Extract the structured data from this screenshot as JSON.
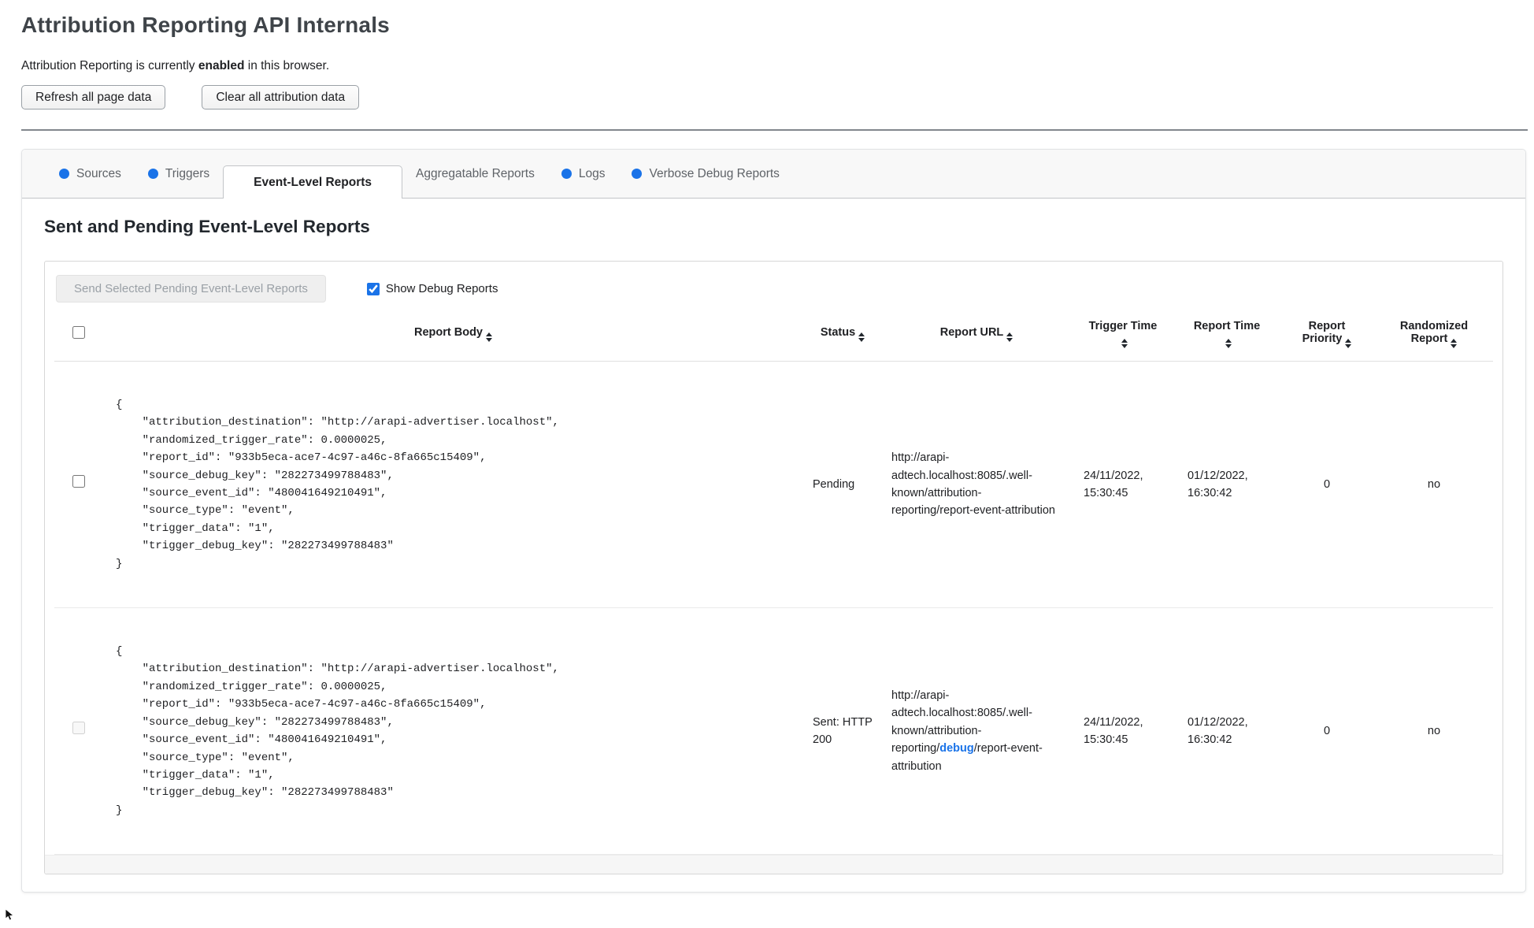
{
  "page": {
    "title": "Attribution Reporting API Internals",
    "status_prefix": "Attribution Reporting is currently ",
    "status_bold": "enabled",
    "status_suffix": " in this browser.",
    "refresh_button": "Refresh all page data",
    "clear_button": "Clear all attribution data"
  },
  "tabs": [
    {
      "label": "Sources",
      "has_dot": true,
      "active": false
    },
    {
      "label": "Triggers",
      "has_dot": true,
      "active": false
    },
    {
      "label": "Event-Level Reports",
      "has_dot": false,
      "active": true
    },
    {
      "label": "Aggregatable Reports",
      "has_dot": false,
      "active": false
    },
    {
      "label": "Logs",
      "has_dot": true,
      "active": false
    },
    {
      "label": "Verbose Debug Reports",
      "has_dot": true,
      "active": false
    }
  ],
  "section": {
    "heading": "Sent and Pending Event-Level Reports",
    "send_button": "Send Selected Pending Event-Level Reports",
    "send_button_disabled": true,
    "show_debug_label": "Show Debug Reports",
    "show_debug_checked": true
  },
  "table": {
    "columns": [
      "Report Body",
      "Status",
      "Report URL",
      "Trigger Time",
      "Report Time",
      "Report Priority",
      "Randomized Report"
    ],
    "rows": [
      {
        "report_body": "{\n    \"attribution_destination\": \"http://arapi-advertiser.localhost\",\n    \"randomized_trigger_rate\": 0.0000025,\n    \"report_id\": \"933b5eca-ace7-4c97-a46c-8fa665c15409\",\n    \"source_debug_key\": \"282273499788483\",\n    \"source_event_id\": \"480041649210491\",\n    \"source_type\": \"event\",\n    \"trigger_data\": \"1\",\n    \"trigger_debug_key\": \"282273499788483\"\n}",
        "status": "Pending",
        "url_before": "http://arapi-adtech.localhost:8085/.well-known/attribution-reporting/report-event-attribution",
        "url_debug": "",
        "url_after": "",
        "trigger_time": "24/11/2022, 15:30:45",
        "report_time": "01/12/2022, 16:30:42",
        "report_priority": "0",
        "randomized_report": "no"
      },
      {
        "report_body": "{\n    \"attribution_destination\": \"http://arapi-advertiser.localhost\",\n    \"randomized_trigger_rate\": 0.0000025,\n    \"report_id\": \"933b5eca-ace7-4c97-a46c-8fa665c15409\",\n    \"source_debug_key\": \"282273499788483\",\n    \"source_event_id\": \"480041649210491\",\n    \"source_type\": \"event\",\n    \"trigger_data\": \"1\",\n    \"trigger_debug_key\": \"282273499788483\"\n}",
        "status": "Sent: HTTP 200",
        "url_before": "http://arapi-adtech.localhost:8085/.well-known/attribution-reporting/",
        "url_debug": "debug",
        "url_after": "/report-event-attribution",
        "checkbox_disabled": true,
        "trigger_time": "24/11/2022, 15:30:45",
        "report_time": "01/12/2022, 16:30:42",
        "report_priority": "0",
        "randomized_report": "no"
      }
    ]
  },
  "colors": {
    "accent_blue": "#1a73e8",
    "debug_link_blue": "#1a73e8",
    "tab_dot_blue": "#1a73e8"
  }
}
